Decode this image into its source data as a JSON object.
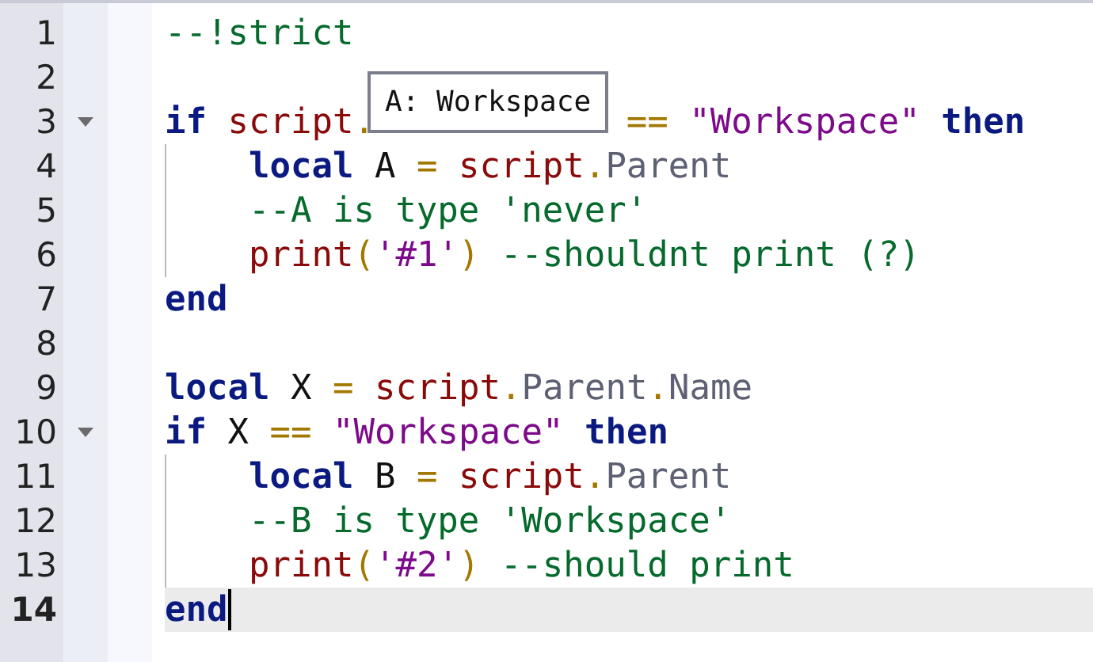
{
  "editor": {
    "lines": [
      {
        "number": "1",
        "tokens": [
          {
            "kind": "comment",
            "text": "--!strict"
          }
        ]
      },
      {
        "number": "2"
      },
      {
        "number": "3",
        "expanded": true,
        "tokens": [
          {
            "kind": "keyword",
            "text": "if "
          },
          {
            "kind": "global",
            "text": "script"
          },
          {
            "kind": "operator",
            "text": "."
          }
        ],
        "tokens_after_tooltip": [
          {
            "kind": "operator",
            "text": "== "
          },
          {
            "kind": "string",
            "text": "\"Workspace\" "
          },
          {
            "kind": "keyword",
            "text": "then"
          }
        ],
        "children": [
          {
            "number": "4",
            "tokens": [
              {
                "kind": "keyword",
                "text": "local"
              },
              {
                "kind": "plain",
                "text": " A "
              },
              {
                "kind": "operator",
                "text": "= "
              },
              {
                "kind": "global",
                "text": "script"
              },
              {
                "kind": "operator",
                "text": "."
              },
              {
                "kind": "property",
                "text": "Parent"
              }
            ]
          },
          {
            "number": "5",
            "tokens": [
              {
                "kind": "comment",
                "text": "--A is type 'never'"
              }
            ]
          },
          {
            "number": "6",
            "tokens": [
              {
                "kind": "global",
                "text": "print"
              },
              {
                "kind": "operator",
                "text": "("
              },
              {
                "kind": "string",
                "text": "'#1'"
              },
              {
                "kind": "operator",
                "text": ") "
              },
              {
                "kind": "comment",
                "text": "--shouldnt print (?)"
              }
            ]
          }
        ]
      },
      {
        "number": "7",
        "tokens": [
          {
            "kind": "keyword",
            "text": "end"
          }
        ]
      },
      {
        "number": "8"
      },
      {
        "number": "9",
        "tokens": [
          {
            "kind": "keyword",
            "text": "local"
          },
          {
            "kind": "plain",
            "text": " X "
          },
          {
            "kind": "operator",
            "text": "= "
          },
          {
            "kind": "global",
            "text": "script"
          },
          {
            "kind": "operator",
            "text": "."
          },
          {
            "kind": "property",
            "text": "Parent"
          },
          {
            "kind": "operator",
            "text": "."
          },
          {
            "kind": "property",
            "text": "Name"
          }
        ]
      },
      {
        "number": "10",
        "expanded": true,
        "tokens": [
          {
            "kind": "keyword",
            "text": "if"
          },
          {
            "kind": "plain",
            "text": " X "
          },
          {
            "kind": "operator",
            "text": "== "
          },
          {
            "kind": "string",
            "text": "\"Workspace\" "
          },
          {
            "kind": "keyword",
            "text": "then"
          }
        ],
        "children": [
          {
            "number": "11",
            "tokens": [
              {
                "kind": "keyword",
                "text": "local"
              },
              {
                "kind": "plain",
                "text": " B "
              },
              {
                "kind": "operator",
                "text": "= "
              },
              {
                "kind": "global",
                "text": "script"
              },
              {
                "kind": "operator",
                "text": "."
              },
              {
                "kind": "property",
                "text": "Parent"
              }
            ]
          },
          {
            "number": "12",
            "tokens": [
              {
                "kind": "comment",
                "text": "--B is type 'Workspace'"
              }
            ]
          },
          {
            "number": "13",
            "tokens": [
              {
                "kind": "global",
                "text": "print"
              },
              {
                "kind": "operator",
                "text": "("
              },
              {
                "kind": "string",
                "text": "'#2'"
              },
              {
                "kind": "operator",
                "text": ") "
              },
              {
                "kind": "comment",
                "text": "--should print"
              }
            ]
          }
        ]
      },
      {
        "number": "14",
        "current": true,
        "tokens": [
          {
            "kind": "keyword",
            "text": "end"
          }
        ]
      }
    ],
    "tooltip": {
      "text": "A: Workspace"
    }
  }
}
